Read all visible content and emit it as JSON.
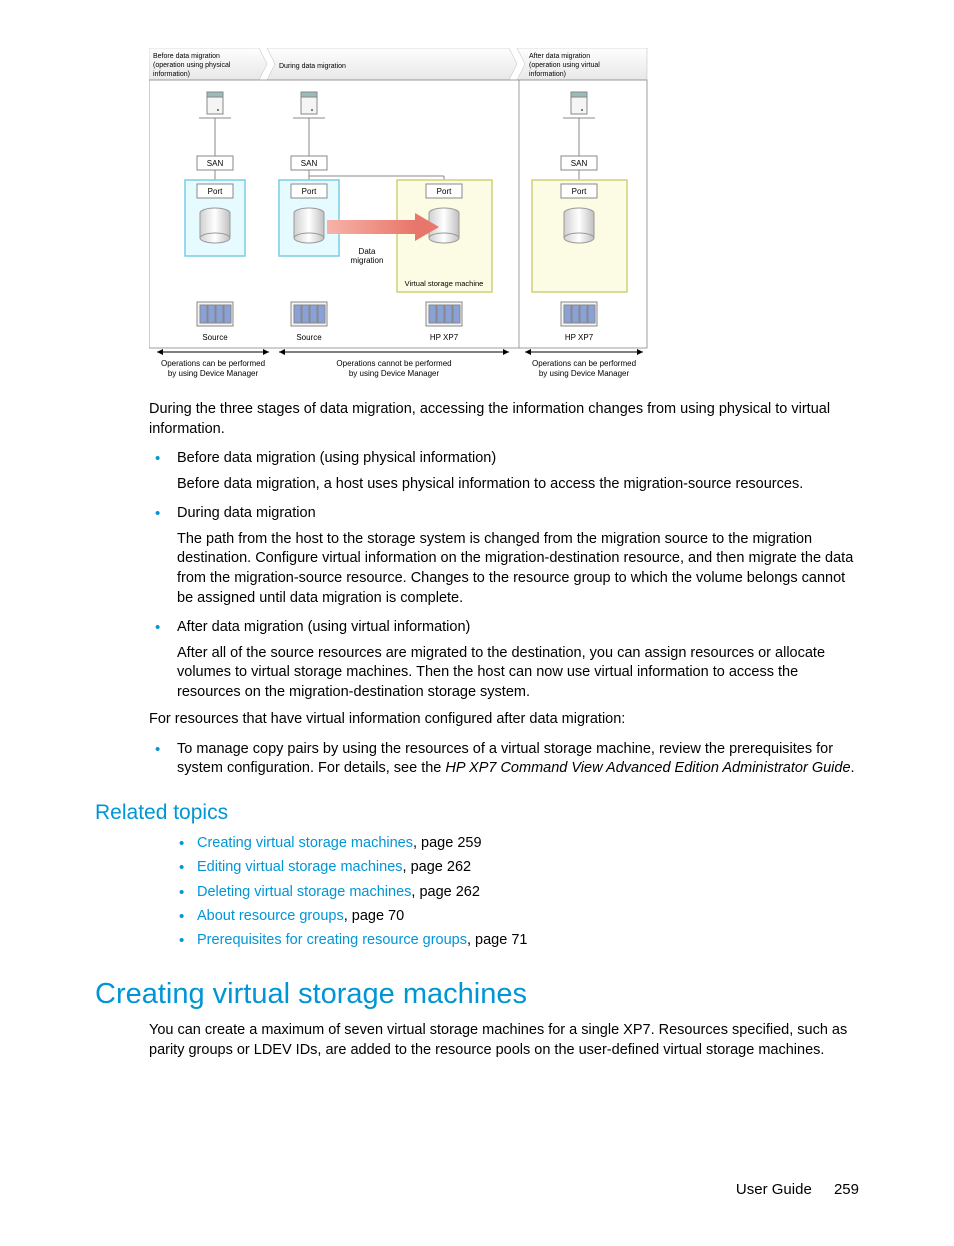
{
  "diagram": {
    "headers": {
      "before": "Before data migration (operation using physical information)",
      "during": "During data migration",
      "after": "After data migration (operation using virtual information)"
    },
    "labels": {
      "san": "SAN",
      "port": "Port",
      "source": "Source",
      "xp7": "HP XP7",
      "data_migration": "Data migration",
      "vsm": "Virtual storage machine"
    },
    "captions": {
      "left": "Operations can be performed by using Device Manager",
      "center": "Operations cannot be performed by using Device Manager",
      "right": "Operations can be performed by using Device Manager"
    }
  },
  "intro_para": "During the three stages of data migration, accessing the information changes from using physical to virtual information.",
  "bullets": [
    {
      "title": "Before data migration (using physical information)",
      "body": "Before data migration, a host uses physical information to access the migration-source resources."
    },
    {
      "title": "During data migration",
      "body": "The path from the host to the storage system is changed from the migration source to the migration destination. Configure virtual information on the migration-destination resource, and then migrate the data from the migration-source resource. Changes to the resource group to which the volume belongs cannot be assigned until data migration is complete."
    },
    {
      "title": "After data migration (using virtual information)",
      "body": "After all of the source resources are migrated to the destination, you can assign resources or allocate volumes to virtual storage machines. Then the host can now use virtual information to access the resources on the migration-destination storage system."
    }
  ],
  "para_after": "For resources that have virtual information configured after data migration:",
  "bullets2": [
    {
      "body_pre": "To manage copy pairs by using the resources of a virtual storage machine, review the prerequisites for system configuration. For details, see the ",
      "body_italic": "HP XP7 Command View Advanced Edition Administrator Guide",
      "body_post": "."
    }
  ],
  "related": {
    "heading": "Related topics",
    "items": [
      {
        "link": "Creating virtual storage machines",
        "suffix": ", page 259"
      },
      {
        "link": "Editing virtual storage machines",
        "suffix": ", page 262"
      },
      {
        "link": "Deleting virtual storage machines",
        "suffix": ", page 262"
      },
      {
        "link": "About resource groups",
        "suffix": ", page 70"
      },
      {
        "link": "Prerequisites for creating resource groups",
        "suffix": ", page 71"
      }
    ]
  },
  "section": {
    "heading": "Creating virtual storage machines",
    "body": "You can create a maximum of seven virtual storage machines for a single XP7. Resources specified, such as parity groups or LDEV IDs, are added to the resource pools on the user-defined virtual storage machines."
  },
  "footer": {
    "label": "User Guide",
    "page": "259"
  }
}
